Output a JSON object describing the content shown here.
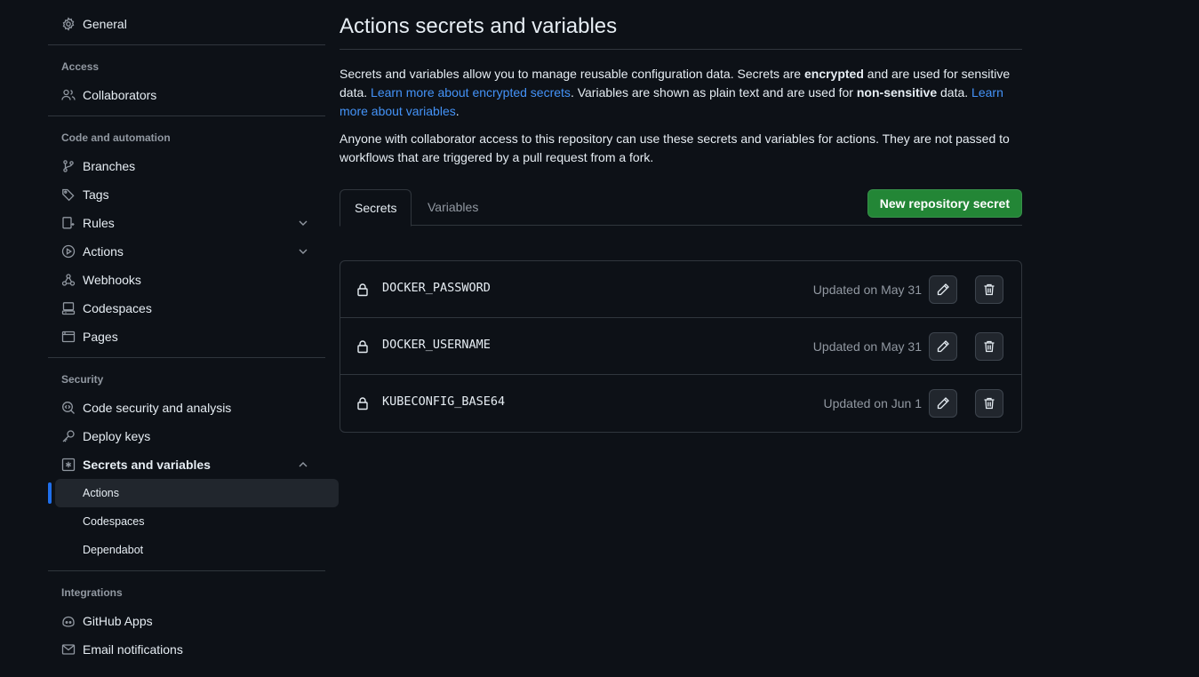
{
  "sidebar": {
    "general": "General",
    "access_title": "Access",
    "collaborators": "Collaborators",
    "code_title": "Code and automation",
    "branches": "Branches",
    "tags": "Tags",
    "rules": "Rules",
    "actions": "Actions",
    "webhooks": "Webhooks",
    "codespaces": "Codespaces",
    "pages": "Pages",
    "security_title": "Security",
    "code_security": "Code security and analysis",
    "deploy_keys": "Deploy keys",
    "secrets_vars": "Secrets and variables",
    "sub_actions": "Actions",
    "sub_codespaces": "Codespaces",
    "sub_dependabot": "Dependabot",
    "integrations_title": "Integrations",
    "github_apps": "GitHub Apps",
    "email_notifications": "Email notifications"
  },
  "main": {
    "title": "Actions secrets and variables",
    "p1": {
      "a": "Secrets and variables allow you to manage reusable configuration data. Secrets are ",
      "b_encrypted": "encrypted",
      "c": " and are used for sensitive data. ",
      "link1": "Learn more about encrypted secrets",
      "d": ". Variables are shown as plain text and are used for ",
      "b_nonsensitive": "non-sensitive",
      "e": " data. ",
      "link2": "Learn more about variables",
      "f": "."
    },
    "p2": "Anyone with collaborator access to this repository can use these secrets and variables for actions. They are not passed to workflows that are triggered by a pull request from a fork.",
    "tabs": [
      "Secrets",
      "Variables"
    ],
    "new_secret_button": "New repository secret",
    "secrets": [
      {
        "name": "DOCKER_PASSWORD",
        "updated": "Updated on May 31"
      },
      {
        "name": "DOCKER_USERNAME",
        "updated": "Updated on May 31"
      },
      {
        "name": "KUBECONFIG_BASE64",
        "updated": "Updated on Jun 1"
      }
    ]
  },
  "colors": {
    "background": "#0d1117",
    "accent": "#1f6feb",
    "link": "#4493f8",
    "primary_button": "#238636",
    "muted_text": "#9198a1"
  }
}
